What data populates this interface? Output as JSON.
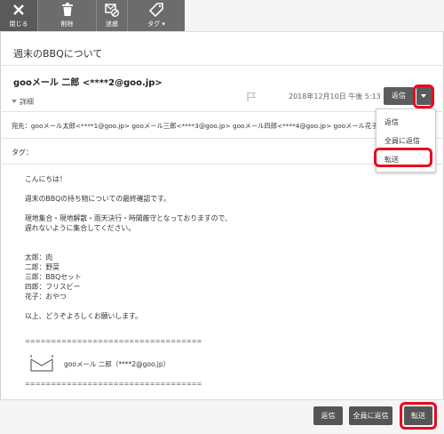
{
  "toolbar": {
    "close_label": "閉じる",
    "delete_label": "削除",
    "spam_label": "迷惑",
    "tag_label": "タグ ▾"
  },
  "mail": {
    "subject": "週末のBBQについて",
    "sender": "gooメール 二郎 <****2@goo.jp>",
    "details_label": "詳細",
    "date": "2018年12月10日 午後 5:13",
    "to": "宛先：gooメール太郎<****1@goo.jp> gooメール三郎<****3@goo.jp> gooメール四郎<****4@goo.jp> gooメール花子<",
    "tag": "タグ：",
    "body_lines": "こんにちは！\n\n週末のBBQの持ち物についての最終確認です。\n\n現地集合・現地解散・雨天決行・時間厳守となっておりますので、\n遅れないように集合してください。\n\n\n太郎：肉\n二郎：野菜\n三郎：BBQセット\n四郎：フリスビー\n花子：おやつ\n\n以上、どうぞよろしくお願いします。",
    "dash_line": "==================================",
    "signature": "gooメール 二郎（****2@goo.jp）"
  },
  "actions": {
    "reply_top": "返信",
    "menu": [
      "返信",
      "全員に返信",
      "転送"
    ],
    "footer_reply": "返信",
    "footer_reply_all": "全員に返信",
    "footer_forward": "転送"
  },
  "colors": {
    "toolbar": "#6c6c6c",
    "button": "#555555",
    "highlight": "#e8091e"
  }
}
